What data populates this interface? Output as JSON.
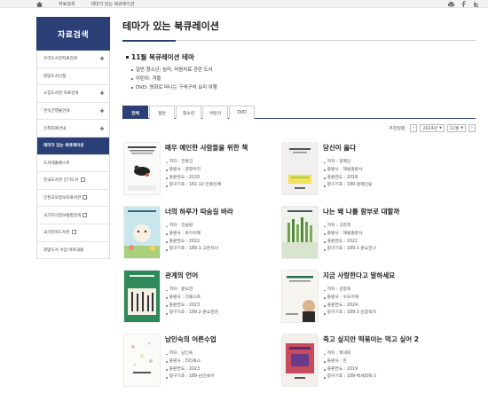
{
  "topbar": {
    "crumbs": [
      "자료검색",
      "테마가 있는 북큐레이션"
    ]
  },
  "sidebar": {
    "title": "자료검색",
    "items": [
      {
        "label": "우리도서관자료검색",
        "suffix": "plus"
      },
      {
        "label": "희망도서신청",
        "suffix": "none"
      },
      {
        "label": "소장도서관 자료검색",
        "suffix": "plus"
      },
      {
        "label": "연속간행물안내",
        "suffix": "plus"
      },
      {
        "label": "신착자료안내",
        "suffix": "plus"
      },
      {
        "label": "테마가 있는 북큐레이션",
        "suffix": "none",
        "active": true
      },
      {
        "label": "도서대출베스트",
        "suffix": "none"
      },
      {
        "label": "전국도서관 인기도서",
        "suffix": "ext"
      },
      {
        "label": "인천교육정보자료서관",
        "suffix": "ext"
      },
      {
        "label": "국가지식정보통합검색",
        "suffix": "ext"
      },
      {
        "label": "국가전자도서관",
        "suffix": "ext"
      },
      {
        "label": "희망도서 서점 바로대출",
        "suffix": "none"
      }
    ]
  },
  "main": {
    "title": "테마가 있는 북큐레이션",
    "theme_heading": "11월 북큐레이션 테마",
    "theme_items": [
      "일반·청소년: 심리, 마음치료 관련 도서",
      "어린이: 겨울",
      "DVD: 영화로 떠나는 구석구석 요리 여행"
    ],
    "tabs": [
      "전체",
      "일반",
      "청소년",
      "어린이",
      "DVD"
    ],
    "filter": {
      "label": "추천일별 :",
      "year": "2024년",
      "month": "11월",
      "prev": "‹",
      "next": "›"
    }
  },
  "books": [
    {
      "title": "매우 예민한 사람들을 위한 책",
      "meta": [
        "저자 : 전홍진",
        "출판사 : 글항아리",
        "출판연도 : 2020",
        "청구기호 : 182.12-전홍진매"
      ]
    },
    {
      "title": "당신이 옳다",
      "meta": [
        "저자 : 정혜신",
        "출판사 : 해냄출판사",
        "출판연도 : 2018",
        "청구기호 : 189-정혜신당"
      ]
    },
    {
      "title": "너의 하루가 따숨길 바라",
      "meta": [
        "저자 : 전승환",
        "출판사 : 토이어웨",
        "출판연도 : 2022",
        "청구기호 : 189.1-고은지너"
      ]
    },
    {
      "title": "나는 왜 나를 함부로 대할까",
      "meta": [
        "저자 : 고은희",
        "출판사 : 해냄출판사",
        "출판연도 : 2022",
        "청구기호 : 189.1-문요한나"
      ]
    },
    {
      "title": "관계의 언어",
      "meta": [
        "저자 : 문요한",
        "출판사 : 더퀘스트",
        "출판연도 : 2023",
        "청구기호 : 189.2-문요한관"
      ]
    },
    {
      "title": "지금 사랑한다고 말하세요",
      "meta": [
        "저자 : 김창옥",
        "출판사 : 수오서재",
        "출판연도 : 2024",
        "청구기호 : 189.1-김창옥지"
      ]
    },
    {
      "title": "남인숙의 어른수업",
      "meta": [
        "저자 : 남인숙",
        "출판사 : 리더북스",
        "출판연도 : 2023",
        "청구기호 : 189-남인숙어"
      ]
    },
    {
      "title": "죽고 싶지만 떡볶이는 먹고 싶어 2",
      "meta": [
        "저자 : 백세희",
        "출판사 : 흔",
        "출판연도 : 2019",
        "청구기호 : 189-백세희죽-2"
      ]
    }
  ],
  "colors": {
    "accent": "#2b3f77"
  }
}
